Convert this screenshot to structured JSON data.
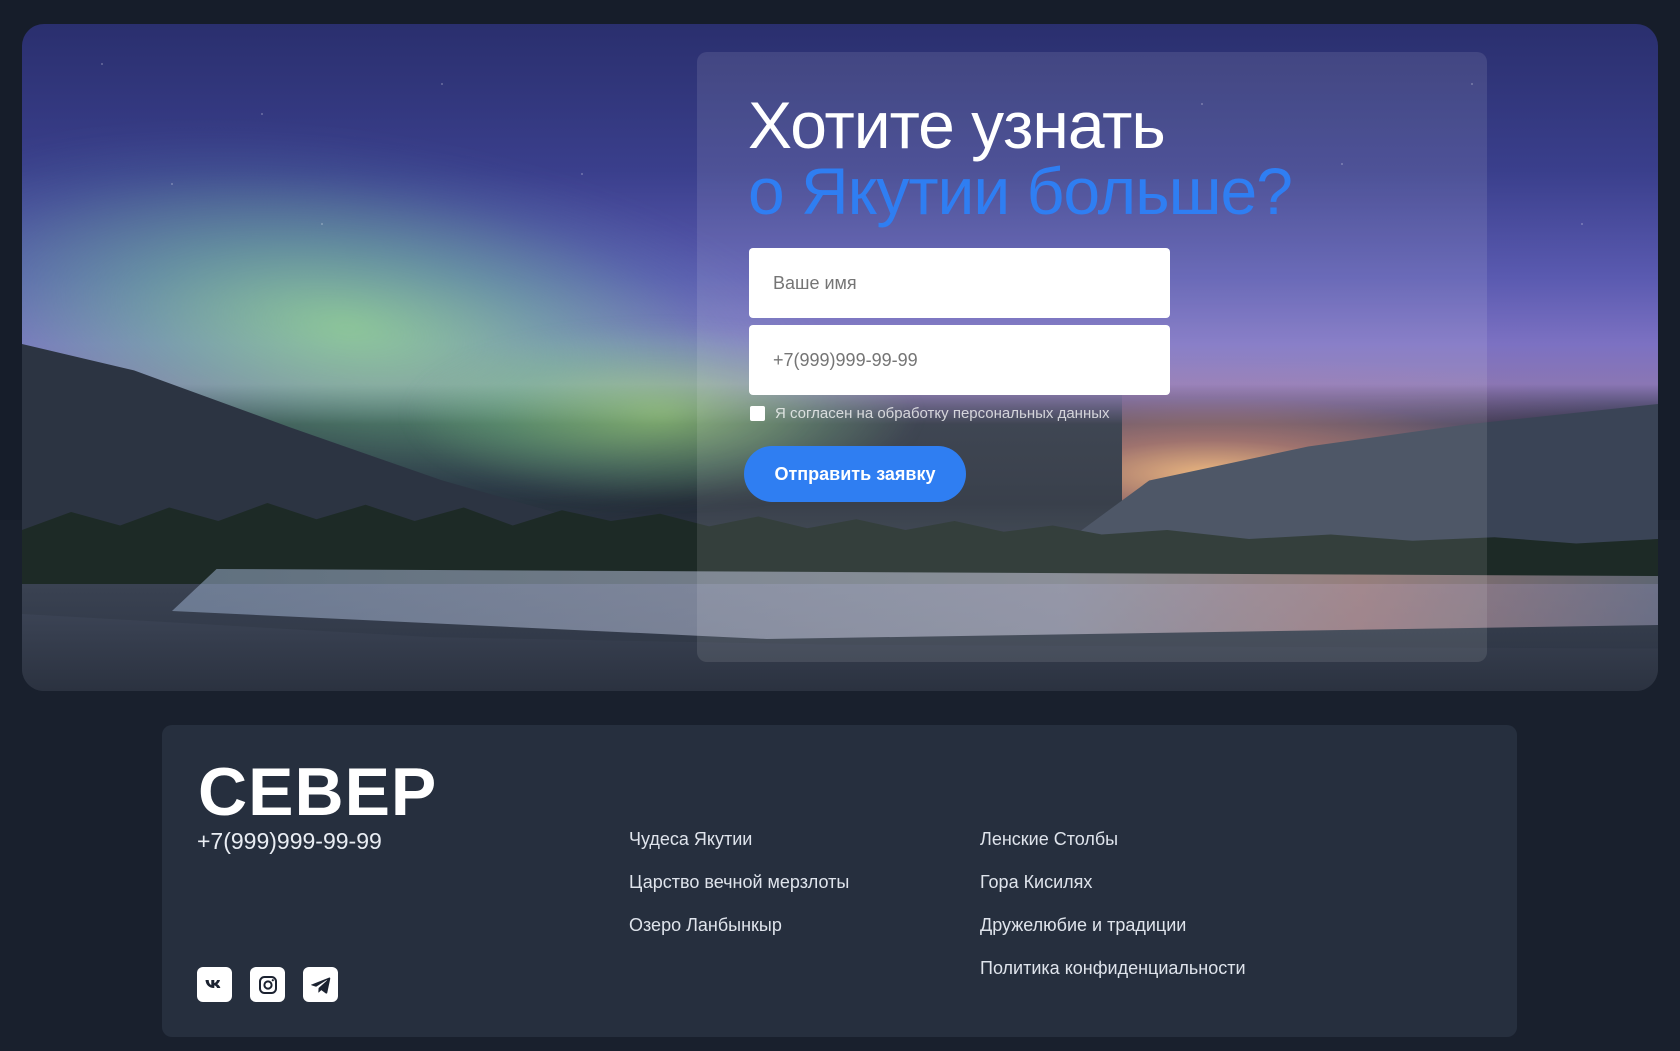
{
  "hero": {
    "title_line1": "Хотите узнать",
    "title_line2": "о Якутии больше?",
    "accent_color": "#2f7ef2"
  },
  "form": {
    "name_placeholder": "Ваше имя",
    "phone_placeholder": "+7(999)999-99-99",
    "consent_label": "Я согласен на обработку персональных данных",
    "consent_checked": false,
    "submit_label": "Отправить заявку"
  },
  "footer": {
    "brand": "СЕВЕР",
    "phone": "+7(999)999-99-99",
    "links_col1": [
      "Чудеса Якутии",
      "Царство вечной мерзлоты",
      "Озеро Ланбынкыр"
    ],
    "links_col2": [
      "Ленские Столбы",
      "Гора Кисилях",
      "Дружелюбие и традиции",
      "Политика конфиденциальности"
    ],
    "socials": [
      "vk-icon",
      "instagram-icon",
      "telegram-icon"
    ]
  }
}
